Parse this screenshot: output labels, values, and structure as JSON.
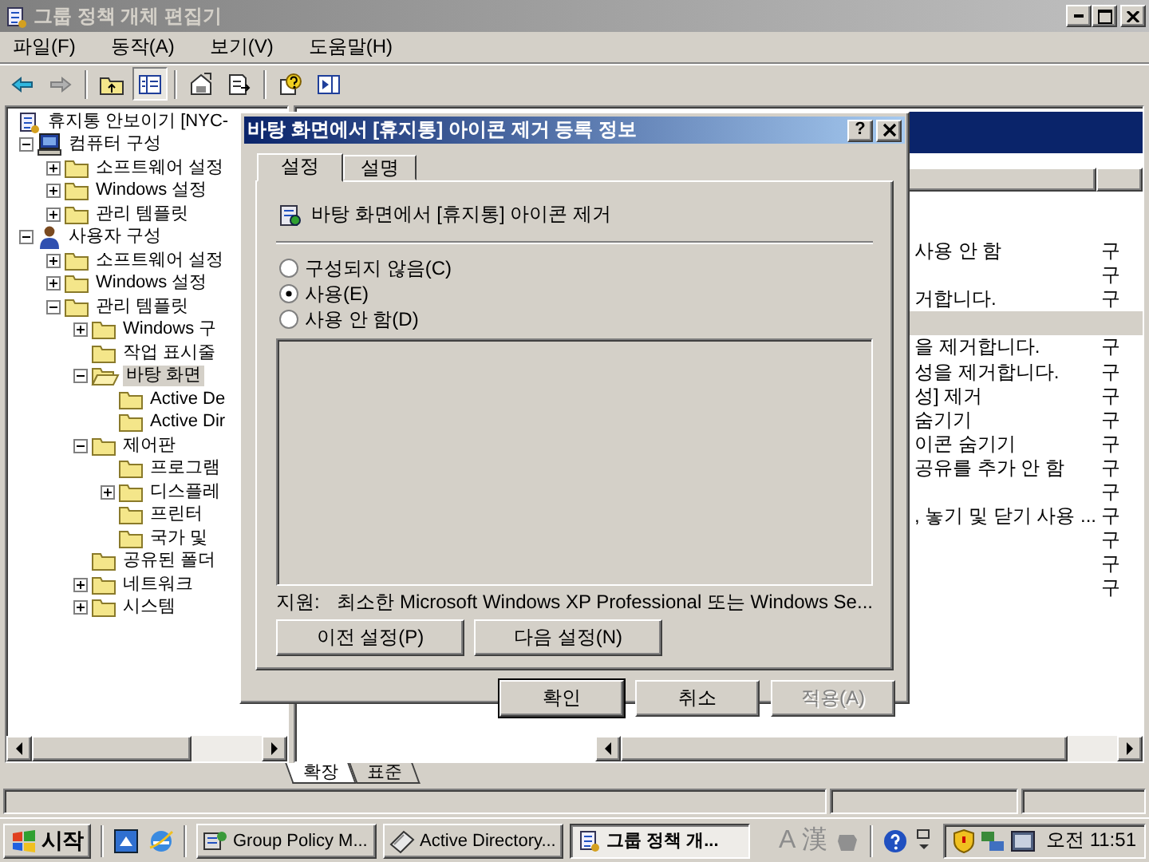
{
  "window": {
    "title": "그룹 정책 개체 편집기",
    "menu": [
      "파일(F)",
      "동작(A)",
      "보기(V)",
      "도움말(H)"
    ]
  },
  "toolbar": [
    {
      "kind": "back",
      "pressed": false
    },
    {
      "kind": "forward",
      "pressed": false
    },
    {
      "kind": "separator"
    },
    {
      "kind": "up",
      "pressed": false
    },
    {
      "kind": "tree",
      "pressed": true
    },
    {
      "kind": "separator"
    },
    {
      "kind": "properties",
      "pressed": false
    },
    {
      "kind": "export",
      "pressed": false
    },
    {
      "kind": "separator"
    },
    {
      "kind": "help",
      "pressed": false
    },
    {
      "kind": "panel",
      "pressed": false
    }
  ],
  "tree": [
    {
      "kind": "policy",
      "label": "휴지통 안보이기 [NYC-",
      "selected": false,
      "children": [
        {
          "kind": "computer",
          "label": "컴퓨터 구성",
          "expanded": true,
          "selected": false,
          "children": [
            {
              "kind": "folder",
              "label": "소프트웨어 설정",
              "expanded": false,
              "selected": false
            },
            {
              "kind": "folder",
              "label": "Windows 설정",
              "expanded": false,
              "selected": false
            },
            {
              "kind": "folder",
              "label": "관리 템플릿",
              "expanded": false,
              "selected": false
            }
          ]
        },
        {
          "kind": "user",
          "label": "사용자 구성",
          "expanded": true,
          "selected": false,
          "children": [
            {
              "kind": "folder",
              "label": "소프트웨어 설정",
              "expanded": false,
              "selected": false
            },
            {
              "kind": "folder",
              "label": "Windows 설정",
              "expanded": false,
              "selected": false
            },
            {
              "kind": "folder",
              "label": "관리 템플릿",
              "expanded": true,
              "selected": false,
              "children": [
                {
                  "kind": "folder",
                  "label": "Windows 구",
                  "expanded": false,
                  "selected": false
                },
                {
                  "kind": "folder",
                  "label": "작업 표시줄",
                  "selected": false
                },
                {
                  "kind": "folder",
                  "label": "바탕 화면",
                  "expanded": true,
                  "selected": true,
                  "children": [
                    {
                      "kind": "folder",
                      "label": "Active De",
                      "selected": false
                    },
                    {
                      "kind": "folder",
                      "label": "Active Dir",
                      "selected": false
                    }
                  ]
                },
                {
                  "kind": "folder",
                  "label": "제어판",
                  "expanded": true,
                  "selected": false,
                  "children": [
                    {
                      "kind": "folder",
                      "label": "프로그램",
                      "selected": false
                    },
                    {
                      "kind": "folder",
                      "label": "디스플레",
                      "expanded": false,
                      "selected": false
                    },
                    {
                      "kind": "folder",
                      "label": "프린터",
                      "selected": false
                    },
                    {
                      "kind": "folder",
                      "label": "국가 및",
                      "selected": false
                    }
                  ]
                },
                {
                  "kind": "folder",
                  "label": "공유된 폴더",
                  "selected": false
                },
                {
                  "kind": "folder",
                  "label": "네트워크",
                  "expanded": false,
                  "selected": false
                },
                {
                  "kind": "folder",
                  "label": "시스템",
                  "expanded": false,
                  "selected": false
                }
              ]
            }
          ]
        }
      ]
    }
  ],
  "list": {
    "rows": [
      {
        "column_1": "사용 안 함",
        "column_2": "구",
        "selected": false
      },
      {
        "column_2": "구",
        "selected": false
      },
      {
        "column_1": "거합니다.",
        "column_2": "구",
        "selected": false
      },
      {
        "selected": true
      },
      {
        "column_1": "을 제거합니다.",
        "column_2": "구",
        "selected": false
      },
      {
        "column_1": "성을 제거합니다.",
        "column_2": "구",
        "selected": false
      },
      {
        "column_1": "성] 제거",
        "column_2": "구",
        "selected": false
      },
      {
        "column_1": "숨기기",
        "column_2": "구",
        "selected": false
      },
      {
        "column_1": "이콘 숨기기",
        "column_2": "구",
        "selected": false
      },
      {
        "column_1": "공유를 추가 안 함",
        "column_2": "구",
        "selected": false
      },
      {
        "column_2": "구",
        "selected": false
      },
      {
        "column_1": ", 놓기 및 닫기 사용 ...",
        "column_2": "구",
        "selected": false
      },
      {
        "column_2": "구",
        "selected": false
      },
      {
        "column_2": "구",
        "selected": false
      },
      {
        "column_2": "구",
        "selected": false
      }
    ]
  },
  "view_tabs": [
    {
      "label": "확장",
      "selected": true
    },
    {
      "label": "표준",
      "selected": false
    }
  ],
  "dialog": {
    "title": "바탕 화면에서 [휴지통] 아이콘 제거 등록 정보",
    "help_button": "?",
    "tabs": [
      {
        "label": "설정",
        "selected": true
      },
      {
        "label": "설명",
        "selected": false
      }
    ],
    "setting": "바탕 화면에서 [휴지통] 아이콘 제거",
    "options": [
      {
        "label": "구성되지 않음(C)",
        "selected": false
      },
      {
        "label": "사용(E)",
        "selected": true
      },
      {
        "label": "사용 안 함(D)",
        "selected": false
      }
    ],
    "support_label": "지원:",
    "support_text": "최소한 Microsoft Windows XP Professional 또는 Windows Se...",
    "nav_buttons": [
      "이전 설정(P)",
      "다음 설정(N)"
    ],
    "buttons": [
      {
        "label": "확인",
        "default": true,
        "disabled": false
      },
      {
        "label": "취소",
        "default": false,
        "disabled": false
      },
      {
        "label": "적용(A)",
        "default": false,
        "disabled": true
      }
    ]
  },
  "taskbar": {
    "start": "시작",
    "tasks": [
      {
        "kind": "console",
        "label": "Group Policy M...",
        "selected": false
      },
      {
        "kind": "book",
        "label": "Active Directory...",
        "selected": false
      },
      {
        "kind": "policy",
        "label": "그룹 정책 개...",
        "selected": true
      }
    ],
    "language": [
      "A",
      "漢"
    ],
    "clock": "오전 11:51"
  }
}
